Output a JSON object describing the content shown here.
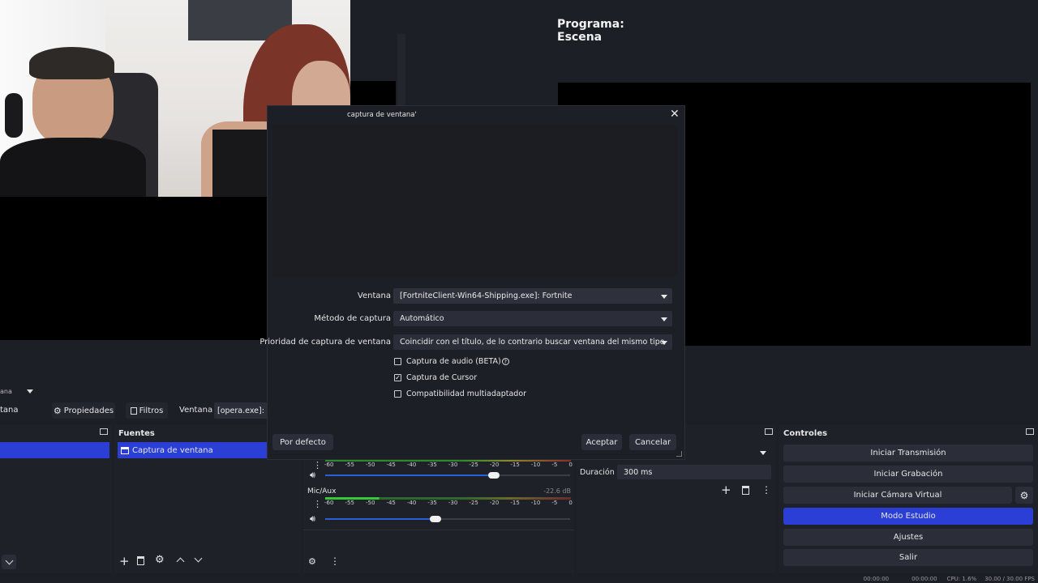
{
  "program": {
    "title": "Programa: Escena"
  },
  "dialog": {
    "title": "captura de ventana'",
    "fields": {
      "window_label": "Ventana",
      "window_value": "[FortniteClient-Win64-Shipping.exe]: Fortnite",
      "method_label": "Método de captura",
      "method_value": "Automático",
      "priority_label": "Prioridad de captura de ventana",
      "priority_value": "Coincidir con el título, de lo contrario buscar ventana del mismo tipo"
    },
    "checkboxes": {
      "audio": "Captura de audio (BETA)",
      "cursor": "Captura de Cursor",
      "multi": "Compatibilidad multiadaptador"
    },
    "buttons": {
      "defaults": "Por defecto",
      "ok": "Aceptar",
      "cancel": "Cancelar"
    }
  },
  "toolbar": {
    "partial_left": "tana",
    "properties": "Propiedades",
    "filters": "Filtros",
    "window_label": "Ventana",
    "window_value": "[opera.exe]: O"
  },
  "scene_dropdown_partial": "ana",
  "sources": {
    "title": "Fuentes",
    "items": [
      "Captura de ventana"
    ]
  },
  "mixer": {
    "tracks": [
      {
        "name": "",
        "db": ""
      },
      {
        "name": "Mic/Aux",
        "db": "-22.6 dB"
      }
    ],
    "ticks": [
      "-60",
      "-55",
      "-50",
      "-45",
      "-40",
      "-35",
      "-30",
      "-25",
      "-20",
      "-15",
      "-10",
      "-5",
      "0"
    ]
  },
  "transitions": {
    "duration_label": "Duración",
    "duration_value": "300 ms"
  },
  "controls": {
    "title": "Controles",
    "buttons": [
      "Iniciar Transmisión",
      "Iniciar Grabación",
      "Iniciar Cámara Virtual",
      "Modo Estudio",
      "Ajustes",
      "Salir"
    ]
  },
  "statusbar": {
    "time1": "00:00:00",
    "time2": "00:00:00",
    "cpu": "CPU: 1.6%",
    "fps": "30.00 / 30.00 FPS"
  },
  "colors": {
    "accent": "#2b3fd6",
    "bg": "#1d1f26"
  }
}
